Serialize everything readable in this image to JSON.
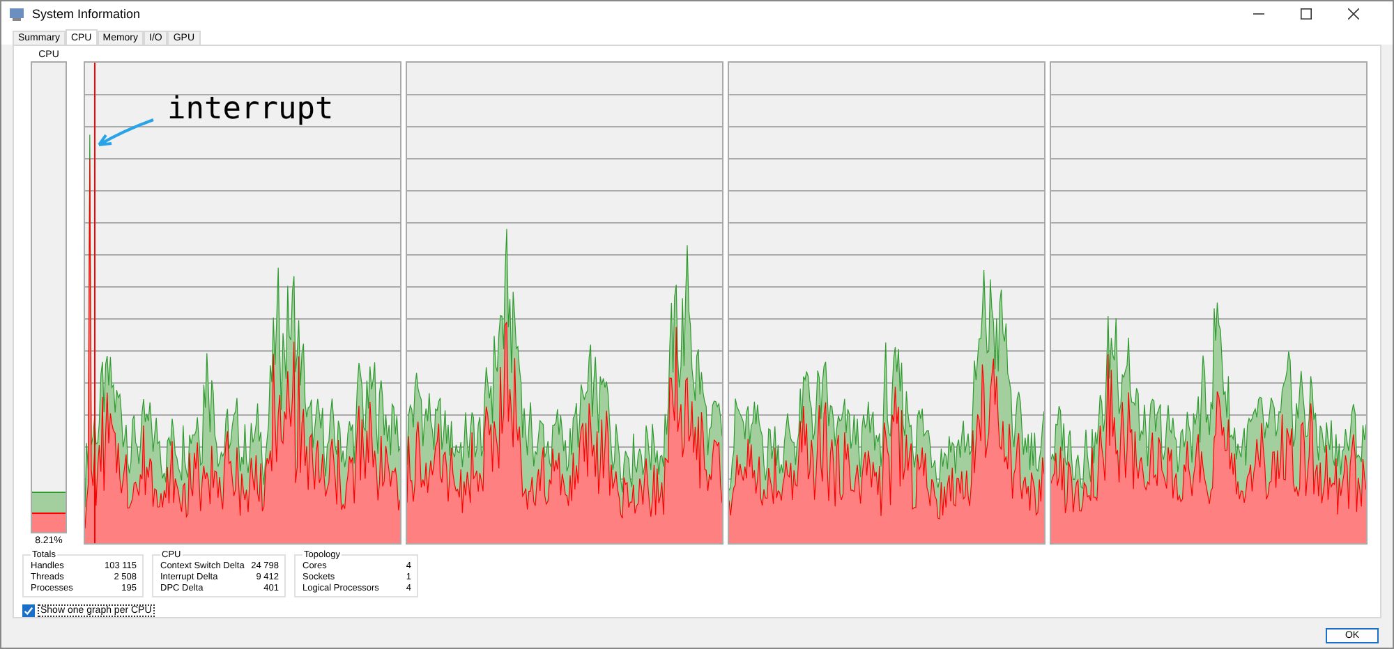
{
  "window": {
    "title": "System Information"
  },
  "tabs": [
    {
      "label": "Summary",
      "selected": false
    },
    {
      "label": "CPU",
      "selected": true
    },
    {
      "label": "Memory",
      "selected": false
    },
    {
      "label": "I/O",
      "selected": false
    },
    {
      "label": "GPU",
      "selected": false
    }
  ],
  "cpu_meter": {
    "title": "CPU",
    "usage": {
      "level": 0.083
    },
    "kernel": {
      "level": 0.04
    },
    "reading": "8.21%"
  },
  "cpu_graphs": [
    {
      "kind": "waveform"
    },
    {
      "kind": "waveform"
    },
    {
      "kind": "waveform"
    },
    {
      "kind": "waveform"
    }
  ],
  "annotation": {
    "text": "interrupt"
  },
  "groups": [
    {
      "title": "Totals",
      "rows": [
        {
          "label": "Handles",
          "value": "103 115"
        },
        {
          "label": "Threads",
          "value": "2 508"
        },
        {
          "label": "Processes",
          "value": "195"
        }
      ]
    },
    {
      "title": "CPU",
      "rows": [
        {
          "label": "Context Switch Delta",
          "value": "24 798"
        },
        {
          "label": "Interrupt Delta",
          "value": "9 412"
        },
        {
          "label": "DPC Delta",
          "value": "401"
        }
      ]
    },
    {
      "title": "Topology",
      "rows": [
        {
          "label": "Cores",
          "value": "4"
        },
        {
          "label": "Sockets",
          "value": "1"
        },
        {
          "label": "Logical Processors",
          "value": "4"
        }
      ]
    }
  ],
  "per_cpu_option": {
    "label": "Show one graph per CPU",
    "checked": true
  },
  "ok_button": {
    "label": "OK"
  }
}
